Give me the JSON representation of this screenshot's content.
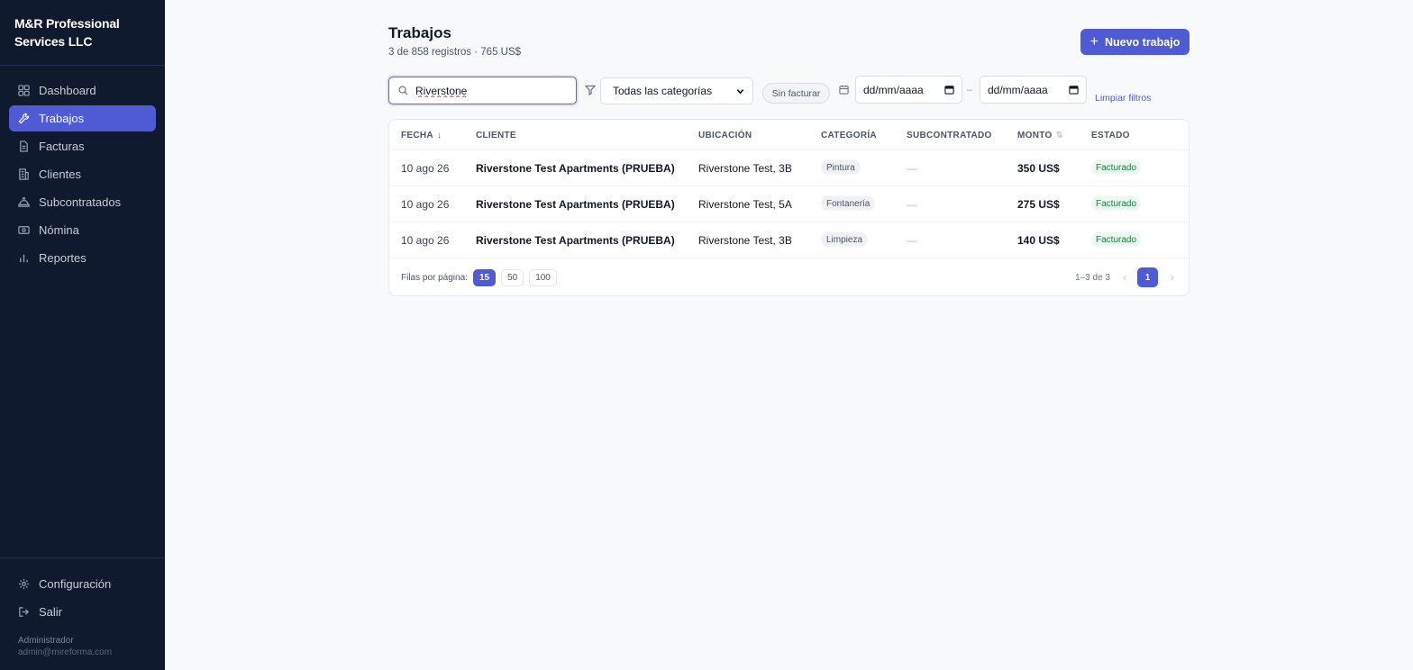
{
  "brand": {
    "name": "M&R Professional Services LLC"
  },
  "sidebar": {
    "items": [
      {
        "label": "Dashboard",
        "icon": "grid-icon"
      },
      {
        "label": "Trabajos",
        "icon": "wrench-icon",
        "active": true
      },
      {
        "label": "Facturas",
        "icon": "document-icon"
      },
      {
        "label": "Clientes",
        "icon": "building-icon"
      },
      {
        "label": "Subcontratados",
        "icon": "hard-hat-icon"
      },
      {
        "label": "Nómina",
        "icon": "cash-icon"
      },
      {
        "label": "Reportes",
        "icon": "bar-chart-icon"
      }
    ],
    "bottom": [
      {
        "label": "Configuración",
        "icon": "gear-icon"
      },
      {
        "label": "Salir",
        "icon": "logout-icon"
      }
    ],
    "user": {
      "role": "Administrador",
      "email": "admin@mireforma.com"
    }
  },
  "header": {
    "title": "Trabajos",
    "subtitle": "3 de 858 registros · 765 US$",
    "new_button": "Nuevo trabajo"
  },
  "filters": {
    "search_value": "Riverstone",
    "category": "Todas las categorías",
    "uninvoiced_chip": "Sin facturar",
    "date_from": "dd/mm/aaaa",
    "date_to": "dd/mm/aaaa",
    "date_separator": "–",
    "clear": "Limpiar filtros"
  },
  "table": {
    "columns": [
      "FECHA",
      "CLIENTE",
      "UBICACIÓN",
      "CATEGORÍA",
      "SUBCONTRATADO",
      "MONTO",
      "ESTADO"
    ],
    "rows": [
      {
        "date": "10 ago 26",
        "client": "Riverstone Test Apartments (PRUEBA)",
        "location": "Riverstone Test, 3B",
        "category": "Pintura",
        "sub": "—",
        "amount": "350 US$",
        "status": "Facturado"
      },
      {
        "date": "10 ago 26",
        "client": "Riverstone Test Apartments (PRUEBA)",
        "location": "Riverstone Test, 5A",
        "category": "Fontanería",
        "sub": "—",
        "amount": "275 US$",
        "status": "Facturado"
      },
      {
        "date": "10 ago 26",
        "client": "Riverstone Test Apartments (PRUEBA)",
        "location": "Riverstone Test, 3B",
        "category": "Limpieza",
        "sub": "—",
        "amount": "140 US$",
        "status": "Facturado"
      }
    ]
  },
  "pagination": {
    "rows_label": "Filas por página:",
    "sizes": [
      "15",
      "50",
      "100"
    ],
    "range": "1–3 de 3",
    "current_page": "1",
    "prev": "‹",
    "next": "›"
  }
}
